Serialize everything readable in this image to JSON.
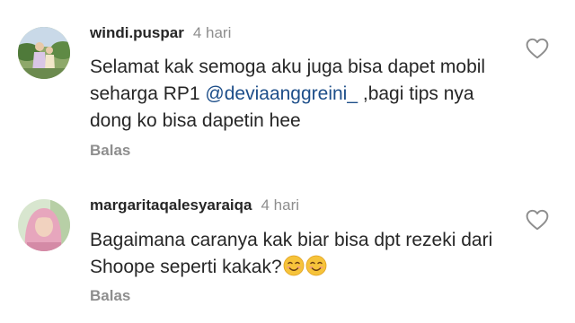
{
  "comments": [
    {
      "username": "windi.puspar",
      "time": "4 hari",
      "text_before": "Selamat kak semoga aku juga bisa dapet mobil seharga RP1 ",
      "mention": "@deviaanggreini_",
      "text_after": " ,bagi tips nya dong ko bisa dapetin hee",
      "reply_label": "Balas"
    },
    {
      "username": "margaritaqalesyaraiqa",
      "time": "4 hari",
      "text": "Bagaimana caranya kak biar bisa dpt rezeki dari Shoope seperti kakak?",
      "emoji_icons": [
        "smiling-face-icon",
        "smiling-face-icon"
      ],
      "reply_label": "Balas"
    }
  ],
  "colors": {
    "text": "#262626",
    "muted": "#8e8e8e",
    "mention": "#1d4e89"
  }
}
